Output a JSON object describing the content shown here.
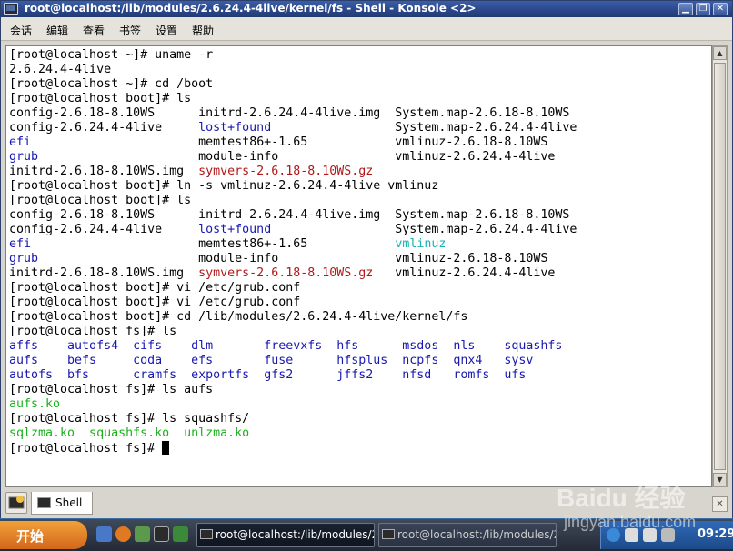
{
  "window": {
    "title": "root@localhost:/lib/modules/2.6.24.4-4live/kernel/fs - Shell - Konsole <2>"
  },
  "menu": [
    "会话",
    "编辑",
    "查看",
    "书签",
    "设置",
    "帮助"
  ],
  "terminal_lines": [
    [
      {
        "t": "[root@localhost ~]# uname -r",
        "c": ""
      }
    ],
    [
      {
        "t": "2.6.24.4-4live",
        "c": ""
      }
    ],
    [
      {
        "t": "[root@localhost ~]# cd /boot",
        "c": ""
      }
    ],
    [
      {
        "t": "[root@localhost boot]# ls",
        "c": ""
      }
    ],
    [
      {
        "t": "config-2.6.18-8.10WS      initrd-2.6.24.4-4live.img  System.map-2.6.18-8.10WS",
        "c": ""
      }
    ],
    [
      {
        "t": "config-2.6.24.4-4live     ",
        "c": ""
      },
      {
        "t": "lost+found",
        "c": "blue"
      },
      {
        "t": "                 System.map-2.6.24.4-4live",
        "c": ""
      }
    ],
    [
      {
        "t": "efi",
        "c": "blue"
      },
      {
        "t": "                       memtest86+-1.65            vmlinuz-2.6.18-8.10WS",
        "c": ""
      }
    ],
    [
      {
        "t": "grub",
        "c": "blue"
      },
      {
        "t": "                      module-info                vmlinuz-2.6.24.4-4live",
        "c": ""
      }
    ],
    [
      {
        "t": "initrd-2.6.18-8.10WS.img  ",
        "c": ""
      },
      {
        "t": "symvers-2.6.18-8.10WS.gz",
        "c": "red"
      }
    ],
    [
      {
        "t": "[root@localhost boot]# ln -s vmlinuz-2.6.24.4-4live vmlinuz",
        "c": ""
      }
    ],
    [
      {
        "t": "[root@localhost boot]# ls",
        "c": ""
      }
    ],
    [
      {
        "t": "config-2.6.18-8.10WS      initrd-2.6.24.4-4live.img  System.map-2.6.18-8.10WS",
        "c": ""
      }
    ],
    [
      {
        "t": "config-2.6.24.4-4live     ",
        "c": ""
      },
      {
        "t": "lost+found",
        "c": "blue"
      },
      {
        "t": "                 System.map-2.6.24.4-4live",
        "c": ""
      }
    ],
    [
      {
        "t": "efi",
        "c": "blue"
      },
      {
        "t": "                       memtest86+-1.65            ",
        "c": ""
      },
      {
        "t": "vmlinuz",
        "c": "cyan"
      }
    ],
    [
      {
        "t": "grub",
        "c": "blue"
      },
      {
        "t": "                      module-info                vmlinuz-2.6.18-8.10WS",
        "c": ""
      }
    ],
    [
      {
        "t": "initrd-2.6.18-8.10WS.img  ",
        "c": ""
      },
      {
        "t": "symvers-2.6.18-8.10WS.gz",
        "c": "red"
      },
      {
        "t": "   vmlinuz-2.6.24.4-4live",
        "c": ""
      }
    ],
    [
      {
        "t": "[root@localhost boot]# vi /etc/grub.conf",
        "c": ""
      }
    ],
    [
      {
        "t": "[root@localhost boot]# vi /etc/grub.conf",
        "c": ""
      }
    ],
    [
      {
        "t": "[root@localhost boot]# cd /lib/modules/2.6.24.4-4live/kernel/fs",
        "c": ""
      }
    ],
    [
      {
        "t": "[root@localhost fs]# ls",
        "c": ""
      }
    ],
    [
      {
        "t": "affs    autofs4  cifs    dlm       freevxfs  hfs      msdos  nls    squashfs",
        "c": "blue"
      }
    ],
    [
      {
        "t": "aufs    befs     coda    efs       fuse      hfsplus  ncpfs  qnx4   sysv",
        "c": "blue"
      }
    ],
    [
      {
        "t": "autofs  bfs      cramfs  exportfs  gfs2      jffs2    nfsd   romfs  ufs",
        "c": "blue"
      }
    ],
    [
      {
        "t": "[root@localhost fs]# ls aufs",
        "c": ""
      }
    ],
    [
      {
        "t": "aufs.ko",
        "c": "green"
      }
    ],
    [
      {
        "t": "[root@localhost fs]# ls squashfs/",
        "c": ""
      }
    ],
    [
      {
        "t": "sqlzma.ko  squashfs.ko  unlzma.ko",
        "c": "green"
      }
    ],
    [
      {
        "t": "[root@localhost fs]# ",
        "c": ""
      }
    ]
  ],
  "tabs": [
    {
      "label": "Shell"
    }
  ],
  "taskbar": {
    "start_label": "开始",
    "tasks": [
      {
        "label": "root@localhost:/lib/modules/2"
      },
      {
        "label": "root@localhost:/lib/modules/2"
      }
    ],
    "clock": "09:29"
  },
  "watermark": {
    "brand": "Baidu 经验",
    "url": "jingyan.baidu.com"
  },
  "colors": {
    "blue": "#1818b2",
    "green": "#18b218",
    "red": "#b21818",
    "cyan": "#18b2b2",
    "title_bar": "#2a4688",
    "start": "#e07a22"
  }
}
